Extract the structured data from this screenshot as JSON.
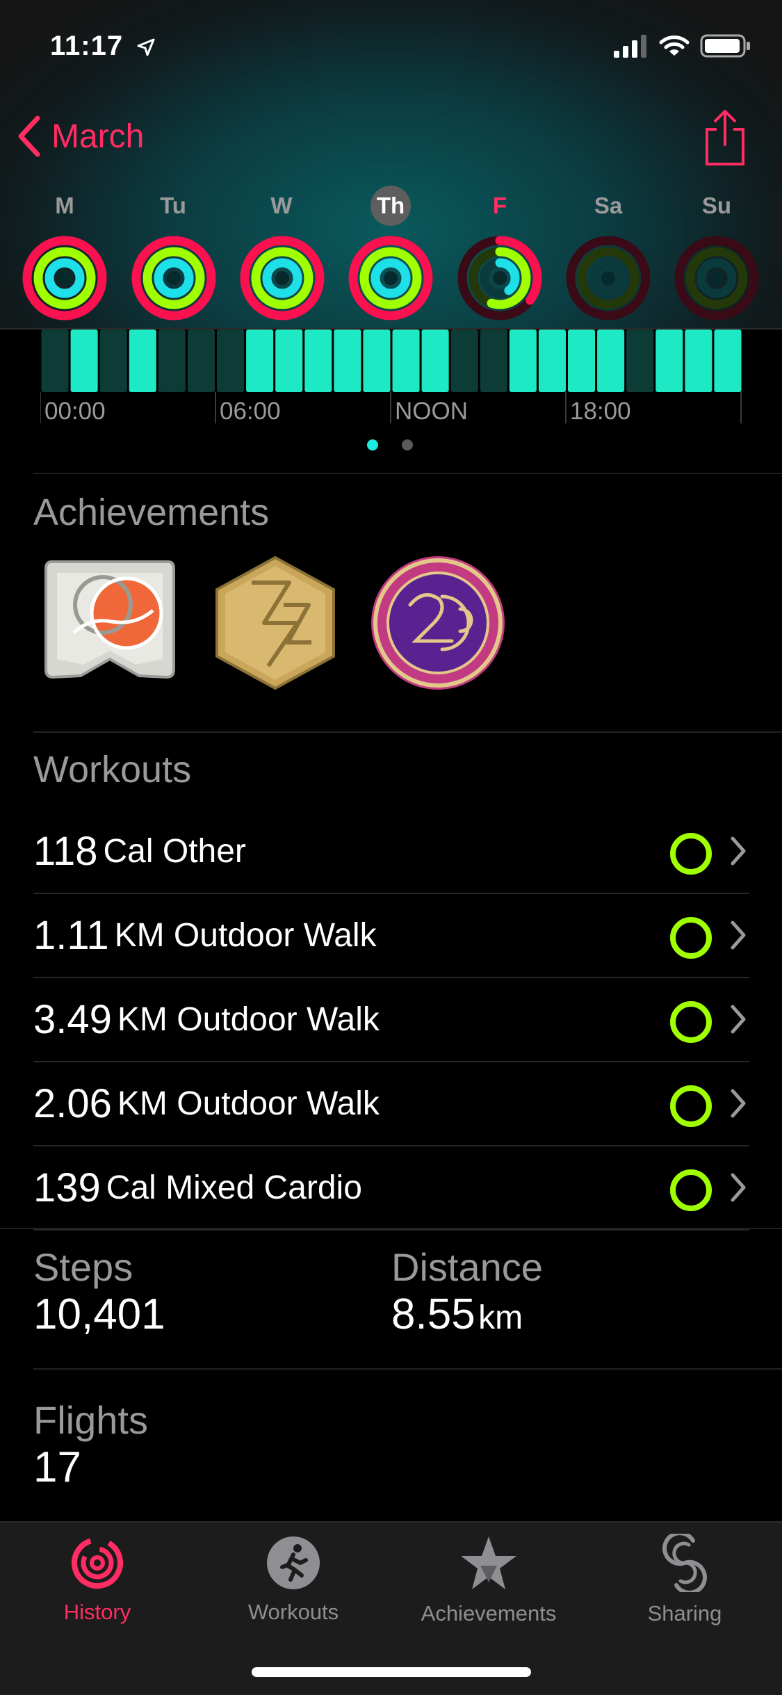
{
  "status_bar": {
    "time": "11:17"
  },
  "nav": {
    "back_label": "March"
  },
  "week": {
    "days": [
      "M",
      "Tu",
      "W",
      "Th",
      "F",
      "Sa",
      "Su"
    ],
    "selected_day": "Th",
    "highlight_day": "F"
  },
  "hourly_chart": {
    "tick_labels": [
      "00:00",
      "06:00",
      "NOON",
      "18:00"
    ],
    "active_segments": [
      0,
      1,
      0,
      1,
      0,
      0,
      0,
      1,
      1,
      1,
      1,
      1,
      1,
      1,
      0,
      0,
      1,
      1,
      1,
      1,
      0,
      1,
      1,
      1
    ]
  },
  "pager": {
    "pages": 2,
    "current": 1
  },
  "achievements": {
    "title": "Achievements",
    "badges": [
      "rings-badge-icon",
      "gold-hexagon-badge-icon",
      "purple-round-badge-icon"
    ]
  },
  "workouts": {
    "title": "Workouts",
    "items": [
      {
        "value": "118",
        "unit": "Cal Other"
      },
      {
        "value": "1.11",
        "unit": "KM Outdoor Walk"
      },
      {
        "value": "3.49",
        "unit": "KM Outdoor Walk"
      },
      {
        "value": "2.06",
        "unit": "KM Outdoor Walk"
      },
      {
        "value": "139",
        "unit": "Cal Mixed Cardio"
      }
    ]
  },
  "stats": {
    "steps": {
      "label": "Steps",
      "value": "10,401"
    },
    "distance": {
      "label": "Distance",
      "value": "8.55",
      "unit": "km"
    },
    "flights": {
      "label": "Flights",
      "value": "17"
    }
  },
  "tabs": [
    {
      "label": "History",
      "active": true
    },
    {
      "label": "Workouts",
      "active": false
    },
    {
      "label": "Achievements",
      "active": false
    },
    {
      "label": "Sharing",
      "active": false
    }
  ],
  "colors": {
    "accent": "#ff2d63",
    "move": "#fa1150",
    "exercise": "#a0ff00",
    "stand": "#1ee0e8",
    "chart_active": "#1de9c4",
    "chart_inactive": "#0d3b36"
  }
}
